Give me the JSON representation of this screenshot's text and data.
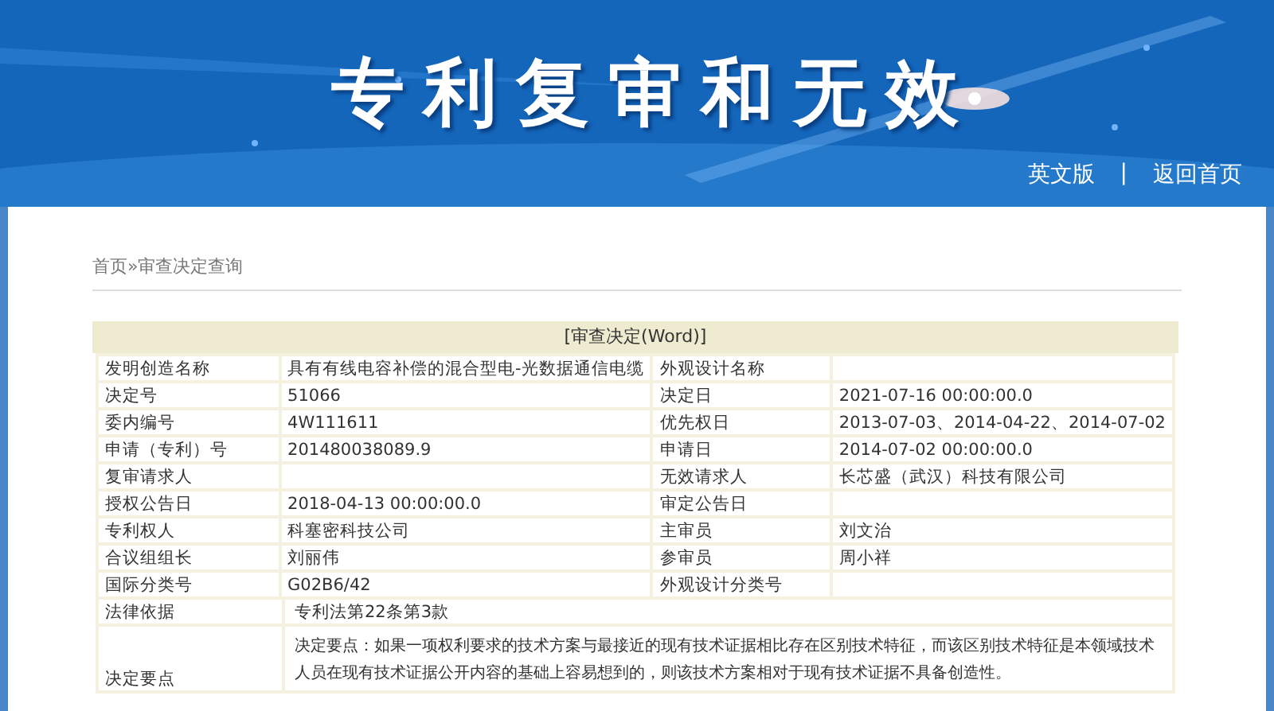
{
  "header": {
    "title": "专利复审和无效",
    "links": [
      "英文版",
      "返回首页"
    ],
    "separator": "|"
  },
  "breadcrumb": "首页»审查决定查询",
  "table": {
    "title": "[审查决定(Word)]",
    "rows": [
      {
        "kind": "pair",
        "cells": [
          "发明创造名称",
          "具有有线电容补偿的混合型电-光数据通信电缆",
          "外观设计名称",
          ""
        ]
      },
      {
        "kind": "pair",
        "cells": [
          "决定号",
          "51066",
          "决定日",
          "2021-07-16 00:00:00.0"
        ]
      },
      {
        "kind": "pair",
        "cells": [
          "委内编号",
          "4W111611",
          "优先权日",
          "2013-07-03、2014-04-22、2014-07-02"
        ]
      },
      {
        "kind": "pair",
        "cells": [
          "申请（专利）号",
          "201480038089.9",
          "申请日",
          "2014-07-02 00:00:00.0"
        ]
      },
      {
        "kind": "pair",
        "cells": [
          "复审请求人",
          "",
          "无效请求人",
          "长芯盛（武汉）科技有限公司"
        ]
      },
      {
        "kind": "pair",
        "cells": [
          "授权公告日",
          "2018-04-13 00:00:00.0",
          "审定公告日",
          ""
        ]
      },
      {
        "kind": "pair",
        "cells": [
          "专利权人",
          "科塞密科技公司",
          "主审员",
          "刘文治"
        ]
      },
      {
        "kind": "pair",
        "cells": [
          "合议组组长",
          "刘丽伟",
          "参审员",
          "周小祥"
        ]
      },
      {
        "kind": "pair",
        "cells": [
          "国际分类号",
          "G02B6/42",
          "外观设计分类号",
          ""
        ]
      }
    ]
  },
  "notes_table": {
    "rows": [
      {
        "kind": "short",
        "cells": [
          "法律依据",
          "专利法第22条第3款"
        ]
      },
      {
        "kind": "tall",
        "cells": [
          "决定要点",
          "决定要点：如果一项权利要求的技术方案与最接近的现有技术证据相比存在区别技术特征，而该区别技术特征是本领域技术人员在现有技术证据公开内容的基础上容易想到的，则该技术方案相对于现有技术证据不具备创造性。"
        ]
      }
    ]
  }
}
